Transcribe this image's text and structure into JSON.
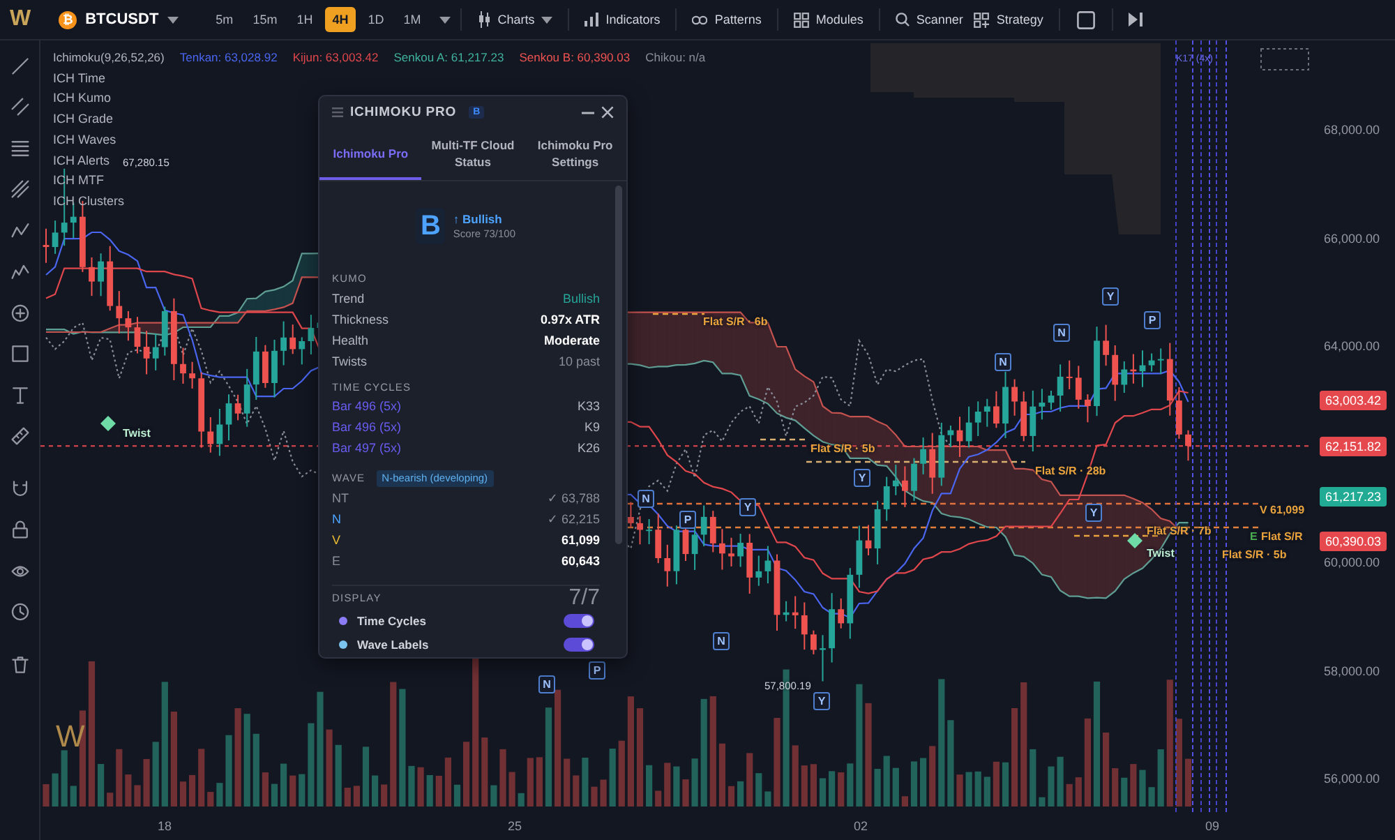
{
  "toolbar": {
    "logo": "W",
    "symbol": {
      "icon": "₿",
      "name": "BTCUSDT"
    },
    "timeframes": [
      {
        "label": "5m",
        "selected": false
      },
      {
        "label": "15m",
        "selected": false
      },
      {
        "label": "1H",
        "selected": false
      },
      {
        "label": "4H",
        "selected": true
      },
      {
        "label": "1D",
        "selected": false
      },
      {
        "label": "1M",
        "selected": false
      }
    ],
    "menus": [
      {
        "label": "Charts",
        "kind": "dropdown"
      },
      {
        "label": "Indicators",
        "kind": "button"
      },
      {
        "label": "Patterns",
        "kind": "button"
      },
      {
        "label": "Modules",
        "kind": "button"
      },
      {
        "label": "Scanner",
        "kind": "button"
      },
      {
        "label": "Strategy",
        "kind": "button"
      }
    ]
  },
  "legend": {
    "title": "Ichimoku(9,26,52,26)",
    "values": [
      {
        "label": "Tenkan: 63,028.92",
        "color": "#4a66f0"
      },
      {
        "label": "Kijun: 63,003.42",
        "color": "#e0474c"
      },
      {
        "label": "Senkou A: 61,217.23",
        "color": "#3fb39e"
      },
      {
        "label": "Senkou B: 60,390.03",
        "color": "#ef5350"
      },
      {
        "label": "Chikou: n/a",
        "color": "#8a8e99"
      }
    ],
    "layers": [
      "ICH Time",
      "ICH Kumo",
      "ICH Grade",
      "ICH Waves",
      "ICH Alerts",
      "ICH MTF",
      "ICH Clusters"
    ]
  },
  "panel": {
    "title": "ICHIMOKU PRO",
    "badge": "B",
    "tabs": [
      {
        "label": "Ichimoku Pro",
        "selected": true
      },
      {
        "label": "Multi-TF Cloud Status",
        "selected": false
      },
      {
        "label": "Ichimoku Pro Settings",
        "selected": false
      }
    ],
    "grade": {
      "letter": "B",
      "trend": "↑ Bullish",
      "score": "Score 73/100"
    },
    "kumo": {
      "heading": "KUMO",
      "rows": [
        {
          "label": "Trend",
          "value": "Bullish",
          "kind": "positive"
        },
        {
          "label": "Thickness",
          "value": "0.97x ATR",
          "kind": "strong"
        },
        {
          "label": "Health",
          "value": "Moderate",
          "kind": "strong"
        },
        {
          "label": "Twists",
          "value": "10 past",
          "kind": "muted"
        }
      ]
    },
    "time_cycles": {
      "heading": "TIME CYCLES",
      "rows": [
        {
          "label": "Bar 496 (5x)",
          "value": "K33"
        },
        {
          "label": "Bar 496 (5x)",
          "value": "K9"
        },
        {
          "label": "Bar 497 (5x)",
          "value": "K26"
        }
      ]
    },
    "wave": {
      "heading": "WAVE",
      "badge": "N-bearish (developing)",
      "rows": [
        {
          "label": "NT",
          "color": "#8a8e99",
          "value": "✓ 63,788",
          "reached": true
        },
        {
          "label": "N",
          "color": "#4da3ff",
          "value": "✓ 62,215",
          "reached": true
        },
        {
          "label": "V",
          "color": "#e8b931",
          "value": "61,099",
          "reached": false
        },
        {
          "label": "E",
          "color": "#8a8e99",
          "value": "60,643",
          "reached": false
        }
      ]
    },
    "display": {
      "heading": "DISPLAY",
      "count": "7/7",
      "toggles": [
        {
          "label": "Time Cycles",
          "color": "#8b7cf6",
          "on": true
        },
        {
          "label": "Wave Labels",
          "color": "#7cc4f0",
          "on": true
        }
      ]
    }
  },
  "chart": {
    "cycle_label": "K17 (4x)",
    "high_label": "67,280.15",
    "low_label": "57,800.19",
    "twists": [
      {
        "label": "Twist"
      },
      {
        "label": "Twist"
      }
    ],
    "levels": [
      {
        "label": "Flat S/R · 6b"
      },
      {
        "label": "Flat S/R · 5b"
      },
      {
        "label": "Flat S/R · 28b"
      },
      {
        "label": "Flat S/R · 7b"
      },
      {
        "label": "Flat S/R · 5b"
      },
      {
        "label": "Flat S/R"
      }
    ],
    "wave_levels": [
      {
        "label": "V 61,099",
        "color": "#e8a33c"
      },
      {
        "label": "E",
        "color": "#4caf50"
      }
    ],
    "markers": [
      {
        "label": "N"
      },
      {
        "label": "P"
      },
      {
        "label": "N"
      },
      {
        "label": "P"
      },
      {
        "label": "N"
      },
      {
        "label": "Y"
      },
      {
        "label": "Y"
      },
      {
        "label": "Y"
      },
      {
        "label": "N"
      },
      {
        "label": "N"
      },
      {
        "label": "Y"
      },
      {
        "label": "Y"
      },
      {
        "label": "P"
      }
    ],
    "logo": "W"
  },
  "price_axis": {
    "ticks": [
      "68,000.00",
      "66,000.00",
      "64,000.00",
      "60,000.00",
      "58,000.00",
      "56,000.00"
    ],
    "tags": [
      {
        "label": "63,003.42",
        "color": "#e5484d"
      },
      {
        "label": "62,151.82",
        "color": "#e5484d"
      },
      {
        "label": "61,217.23",
        "color": "#22ab94"
      },
      {
        "label": "60,390.03",
        "color": "#e5484d"
      }
    ]
  },
  "time_axis": {
    "ticks": [
      "18",
      "25",
      "02",
      "09"
    ]
  }
}
